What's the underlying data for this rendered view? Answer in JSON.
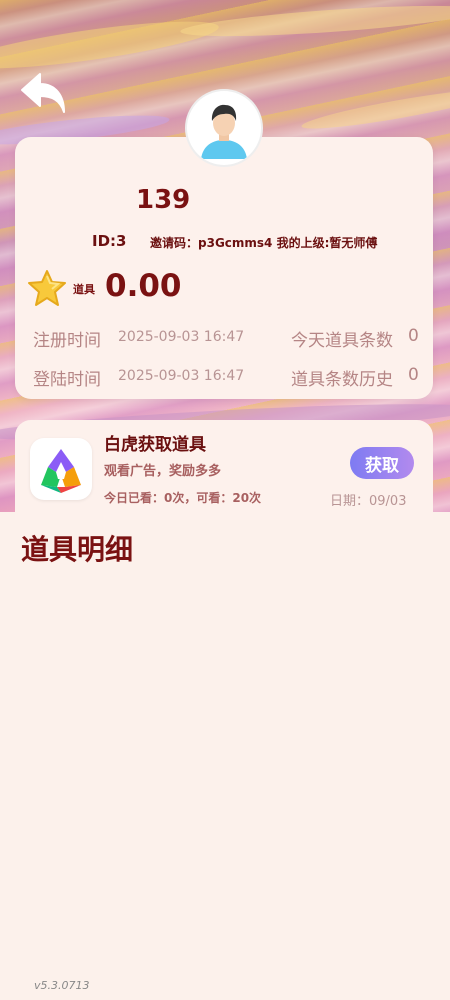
{
  "user": {
    "name": "139",
    "id": "ID:3",
    "invite": "邀请码：p3Gcmms4  我的上级:暂无师傅"
  },
  "props": {
    "label": "道具",
    "value": "0.00"
  },
  "info": {
    "register_label": "注册时间",
    "register_time": "2025-09-03 16:47",
    "login_label": "登陆时间",
    "login_time": "2025-09-03 16:47",
    "today_label": "今天道具条数",
    "today_value": "0",
    "history_label": "道具条数历史",
    "history_value": "0"
  },
  "task": {
    "title": "白虎获取道具",
    "subtitle": "观看广告，奖励多多",
    "count": "今日已看：0次，可看：20次",
    "button": "获取",
    "date": "日期：09/03"
  },
  "section": {
    "title": "道具明细"
  },
  "footer": {
    "version": "v5.3.0713"
  },
  "icons": {
    "back": "back-arrow-icon",
    "star": "star-icon",
    "app": "app-logo-icon",
    "avatar": "avatar"
  },
  "colors": {
    "accent": "#7a1212",
    "button_start": "#7e7bf2",
    "button_end": "#b28aee",
    "background": "#fcf1eb"
  }
}
